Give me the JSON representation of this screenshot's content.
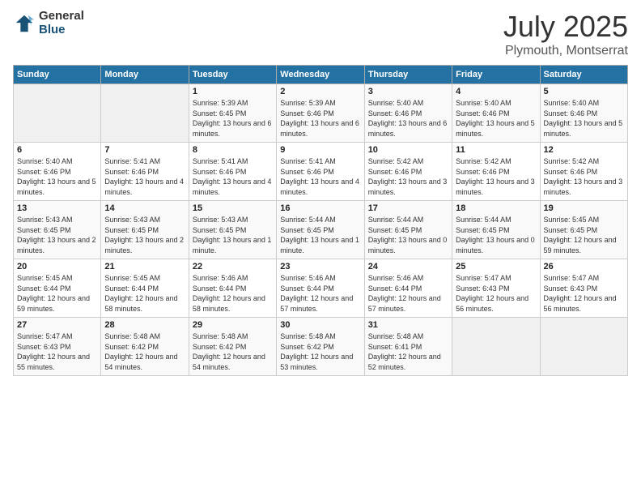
{
  "logo": {
    "general": "General",
    "blue": "Blue"
  },
  "header": {
    "month": "July 2025",
    "location": "Plymouth, Montserrat"
  },
  "weekdays": [
    "Sunday",
    "Monday",
    "Tuesday",
    "Wednesday",
    "Thursday",
    "Friday",
    "Saturday"
  ],
  "weeks": [
    [
      {
        "day": "",
        "sunrise": "",
        "sunset": "",
        "daylight": ""
      },
      {
        "day": "",
        "sunrise": "",
        "sunset": "",
        "daylight": ""
      },
      {
        "day": "1",
        "sunrise": "Sunrise: 5:39 AM",
        "sunset": "Sunset: 6:45 PM",
        "daylight": "Daylight: 13 hours and 6 minutes."
      },
      {
        "day": "2",
        "sunrise": "Sunrise: 5:39 AM",
        "sunset": "Sunset: 6:46 PM",
        "daylight": "Daylight: 13 hours and 6 minutes."
      },
      {
        "day": "3",
        "sunrise": "Sunrise: 5:40 AM",
        "sunset": "Sunset: 6:46 PM",
        "daylight": "Daylight: 13 hours and 6 minutes."
      },
      {
        "day": "4",
        "sunrise": "Sunrise: 5:40 AM",
        "sunset": "Sunset: 6:46 PM",
        "daylight": "Daylight: 13 hours and 5 minutes."
      },
      {
        "day": "5",
        "sunrise": "Sunrise: 5:40 AM",
        "sunset": "Sunset: 6:46 PM",
        "daylight": "Daylight: 13 hours and 5 minutes."
      }
    ],
    [
      {
        "day": "6",
        "sunrise": "Sunrise: 5:40 AM",
        "sunset": "Sunset: 6:46 PM",
        "daylight": "Daylight: 13 hours and 5 minutes."
      },
      {
        "day": "7",
        "sunrise": "Sunrise: 5:41 AM",
        "sunset": "Sunset: 6:46 PM",
        "daylight": "Daylight: 13 hours and 4 minutes."
      },
      {
        "day": "8",
        "sunrise": "Sunrise: 5:41 AM",
        "sunset": "Sunset: 6:46 PM",
        "daylight": "Daylight: 13 hours and 4 minutes."
      },
      {
        "day": "9",
        "sunrise": "Sunrise: 5:41 AM",
        "sunset": "Sunset: 6:46 PM",
        "daylight": "Daylight: 13 hours and 4 minutes."
      },
      {
        "day": "10",
        "sunrise": "Sunrise: 5:42 AM",
        "sunset": "Sunset: 6:46 PM",
        "daylight": "Daylight: 13 hours and 3 minutes."
      },
      {
        "day": "11",
        "sunrise": "Sunrise: 5:42 AM",
        "sunset": "Sunset: 6:46 PM",
        "daylight": "Daylight: 13 hours and 3 minutes."
      },
      {
        "day": "12",
        "sunrise": "Sunrise: 5:42 AM",
        "sunset": "Sunset: 6:46 PM",
        "daylight": "Daylight: 13 hours and 3 minutes."
      }
    ],
    [
      {
        "day": "13",
        "sunrise": "Sunrise: 5:43 AM",
        "sunset": "Sunset: 6:45 PM",
        "daylight": "Daylight: 13 hours and 2 minutes."
      },
      {
        "day": "14",
        "sunrise": "Sunrise: 5:43 AM",
        "sunset": "Sunset: 6:45 PM",
        "daylight": "Daylight: 13 hours and 2 minutes."
      },
      {
        "day": "15",
        "sunrise": "Sunrise: 5:43 AM",
        "sunset": "Sunset: 6:45 PM",
        "daylight": "Daylight: 13 hours and 1 minute."
      },
      {
        "day": "16",
        "sunrise": "Sunrise: 5:44 AM",
        "sunset": "Sunset: 6:45 PM",
        "daylight": "Daylight: 13 hours and 1 minute."
      },
      {
        "day": "17",
        "sunrise": "Sunrise: 5:44 AM",
        "sunset": "Sunset: 6:45 PM",
        "daylight": "Daylight: 13 hours and 0 minutes."
      },
      {
        "day": "18",
        "sunrise": "Sunrise: 5:44 AM",
        "sunset": "Sunset: 6:45 PM",
        "daylight": "Daylight: 13 hours and 0 minutes."
      },
      {
        "day": "19",
        "sunrise": "Sunrise: 5:45 AM",
        "sunset": "Sunset: 6:45 PM",
        "daylight": "Daylight: 12 hours and 59 minutes."
      }
    ],
    [
      {
        "day": "20",
        "sunrise": "Sunrise: 5:45 AM",
        "sunset": "Sunset: 6:44 PM",
        "daylight": "Daylight: 12 hours and 59 minutes."
      },
      {
        "day": "21",
        "sunrise": "Sunrise: 5:45 AM",
        "sunset": "Sunset: 6:44 PM",
        "daylight": "Daylight: 12 hours and 58 minutes."
      },
      {
        "day": "22",
        "sunrise": "Sunrise: 5:46 AM",
        "sunset": "Sunset: 6:44 PM",
        "daylight": "Daylight: 12 hours and 58 minutes."
      },
      {
        "day": "23",
        "sunrise": "Sunrise: 5:46 AM",
        "sunset": "Sunset: 6:44 PM",
        "daylight": "Daylight: 12 hours and 57 minutes."
      },
      {
        "day": "24",
        "sunrise": "Sunrise: 5:46 AM",
        "sunset": "Sunset: 6:44 PM",
        "daylight": "Daylight: 12 hours and 57 minutes."
      },
      {
        "day": "25",
        "sunrise": "Sunrise: 5:47 AM",
        "sunset": "Sunset: 6:43 PM",
        "daylight": "Daylight: 12 hours and 56 minutes."
      },
      {
        "day": "26",
        "sunrise": "Sunrise: 5:47 AM",
        "sunset": "Sunset: 6:43 PM",
        "daylight": "Daylight: 12 hours and 56 minutes."
      }
    ],
    [
      {
        "day": "27",
        "sunrise": "Sunrise: 5:47 AM",
        "sunset": "Sunset: 6:43 PM",
        "daylight": "Daylight: 12 hours and 55 minutes."
      },
      {
        "day": "28",
        "sunrise": "Sunrise: 5:48 AM",
        "sunset": "Sunset: 6:42 PM",
        "daylight": "Daylight: 12 hours and 54 minutes."
      },
      {
        "day": "29",
        "sunrise": "Sunrise: 5:48 AM",
        "sunset": "Sunset: 6:42 PM",
        "daylight": "Daylight: 12 hours and 54 minutes."
      },
      {
        "day": "30",
        "sunrise": "Sunrise: 5:48 AM",
        "sunset": "Sunset: 6:42 PM",
        "daylight": "Daylight: 12 hours and 53 minutes."
      },
      {
        "day": "31",
        "sunrise": "Sunrise: 5:48 AM",
        "sunset": "Sunset: 6:41 PM",
        "daylight": "Daylight: 12 hours and 52 minutes."
      },
      {
        "day": "",
        "sunrise": "",
        "sunset": "",
        "daylight": ""
      },
      {
        "day": "",
        "sunrise": "",
        "sunset": "",
        "daylight": ""
      }
    ]
  ]
}
